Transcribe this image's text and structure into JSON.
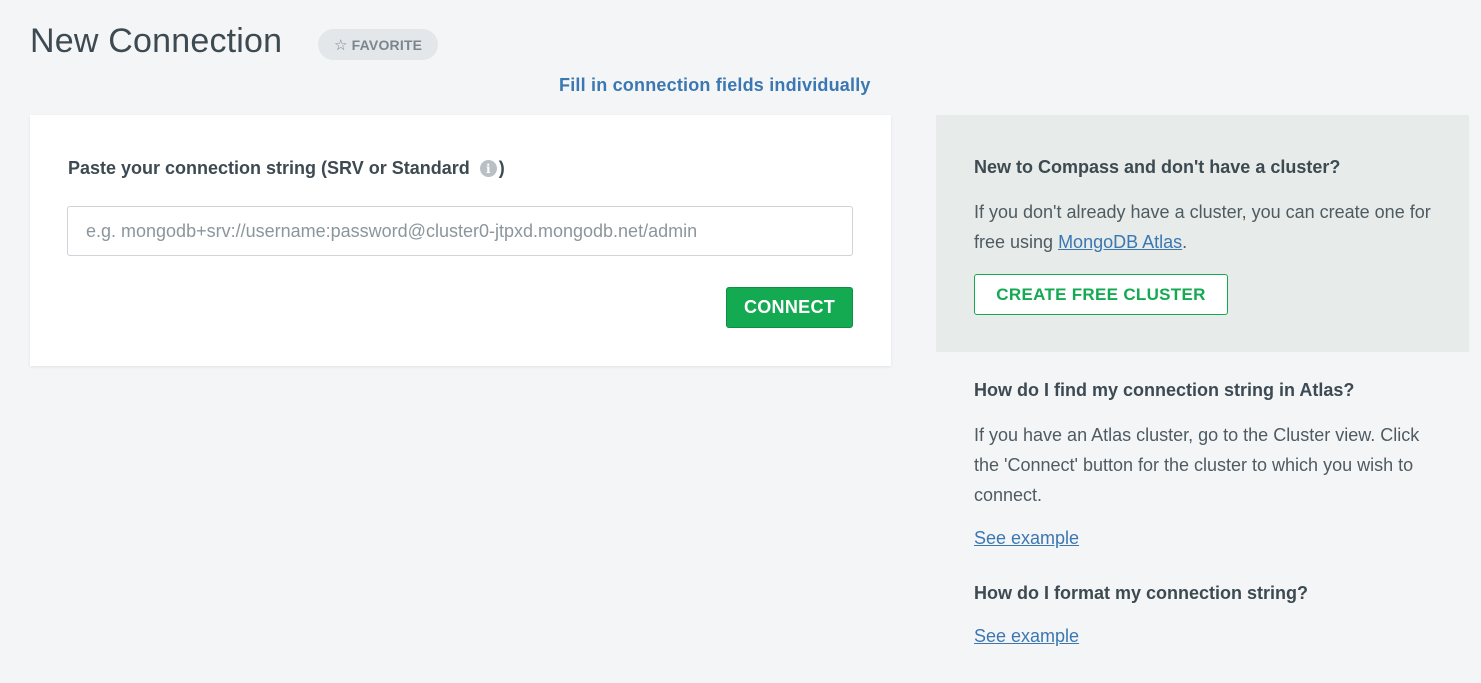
{
  "header": {
    "title": "New Connection",
    "favorite_label": "FAVORITE",
    "favorite_icon": "star-outline-icon"
  },
  "fill_individually_link": "Fill in connection fields individually",
  "connection_card": {
    "label": "Paste your connection string (SRV or Standard",
    "label_suffix": ")",
    "info_icon": "info-icon",
    "input_value": "",
    "input_placeholder": "e.g. mongodb+srv://username:password@cluster0-jtpxd.mongodb.net/admin",
    "connect_label": "CONNECT"
  },
  "sidebar": {
    "new_cluster": {
      "heading": "New to Compass and don't have a cluster?",
      "text": "If you don't already have a cluster, you can create one for free using ",
      "link_text": "MongoDB Atlas",
      "text_end": ".",
      "button_label": "CREATE FREE CLUSTER"
    },
    "find_string": {
      "heading": "How do I find my connection string in Atlas?",
      "text": "If you have an Atlas cluster, go to the Cluster view. Click the 'Connect' button for the cluster to which you wish to connect.",
      "link_text": "See example"
    },
    "format_string": {
      "heading": "How do I format my connection string?",
      "link_text": "See example"
    }
  },
  "colors": {
    "accent_green": "#13aa52",
    "link_blue": "#3b77b1",
    "background": "#f4f5f7"
  }
}
